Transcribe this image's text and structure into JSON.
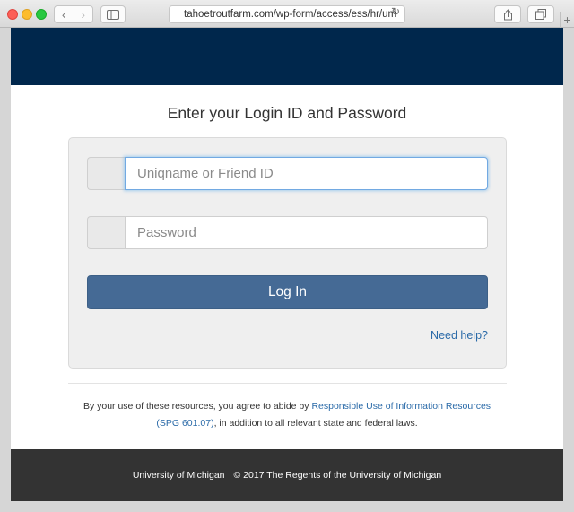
{
  "browser": {
    "url": "tahoetroutfarm.com/wp-form/access/ess/hr/um",
    "back_icon": "chevron-left-icon",
    "forward_icon": "chevron-right-icon",
    "sidebar_icon": "sidebar-icon",
    "reload_icon": "reload-icon",
    "share_icon": "share-icon",
    "tabs_icon": "tabs-icon",
    "new_tab": "+"
  },
  "login": {
    "heading": "Enter your Login ID and Password",
    "username_placeholder": "Uniqname or Friend ID",
    "password_placeholder": "Password",
    "button_label": "Log In",
    "help_link": "Need help?"
  },
  "terms": {
    "before": "By your use of these resources, you agree to abide by ",
    "link": "Responsible Use of Information Resources (SPG 601.07)",
    "after": ", in addition to all relevant state and federal laws."
  },
  "footer": {
    "university": "University of Michigan",
    "copyright": "© 2017 The Regents of the University of Michigan"
  },
  "colors": {
    "header": "#00274c",
    "button": "#456a95",
    "link": "#2a6aa8",
    "footer": "#333333"
  }
}
